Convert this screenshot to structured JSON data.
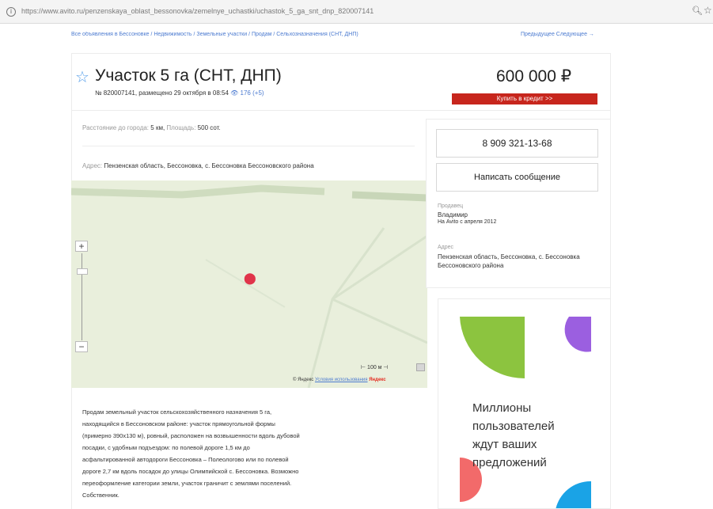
{
  "browser": {
    "url": "https://www.avito.ru/penzenskaya_oblast_bessonovka/zemelnye_uchastki/uchastok_5_ga_snt_dnp_820007141",
    "info_icon": "info-icon",
    "zoom_icon": "zoom-icon",
    "bookmark_icon": "star-icon"
  },
  "breadcrumbs": {
    "text": "Все объявления в Бессоновке / Недвижимость / Земельные участки / Продам / Сельхозназначения (СНТ, ДНП)",
    "right": "Предыдущее   Следующее →"
  },
  "listing": {
    "title": "Участок 5 га (СНТ, ДНП)",
    "meta": "№ 820007141, размещено 29 октября в 08:54",
    "views": "176 (+5)",
    "price": "600 000 ₽",
    "credit_button": "Купить в кредит >>"
  },
  "params": {
    "distance_label": "Расстояние до города:",
    "distance_value": "5 км",
    "area_label": "Площадь:",
    "area_value": "500 сот."
  },
  "address": {
    "label": "Адрес:",
    "value": "Пензенская область, Бессоновка, с. Бессоновка Бессоновского района"
  },
  "map": {
    "zoom_in": "+",
    "zoom_out": "−",
    "scale": "100 м",
    "credit_prefix": "© Яндекс",
    "credit_link": "Условия использования",
    "credit_brand": "Яндекс",
    "pin_color": "#e0344a"
  },
  "description": [
    "Продам земельный участок сельскохозяйственного назначения 5 га,",
    "находящийся в Бессоновском районе: участок прямоугольной формы",
    "(примерно 390х130 м), ровный, расположен на возвышенности вдоль дубовой",
    "посадки, с удобным подъездом: по полевой дороге 1,5 км до",
    "асфальтированной автодороги Бессоновка – Полеологово или по полевой",
    "дороге 2,7 км вдоль посадок до улицы Олимпийской с. Бессоновка. Возможно",
    "переоформление категории земли, участок граничит с землями поселений.",
    "Собственник."
  ],
  "contact": {
    "phone": "8 909 321-13-68",
    "message_button": "Написать сообщение",
    "seller_label": "Продавец",
    "seller_name": "Владимир",
    "seller_since": "На Avito с апреля 2012",
    "address_label": "Адрес",
    "address_value": "Пензенская область, Бессоновка, с. Бессоновка Бессоновского района"
  },
  "ad": {
    "lines": [
      "Миллионы",
      "пользователей",
      "ждут ваших",
      "предложений"
    ]
  },
  "colors": {
    "link": "#4c7bd0",
    "credit_red": "#c7261d",
    "ad_green": "#8cc43f",
    "ad_purple": "#9b5fe0",
    "ad_red": "#f26a6a",
    "ad_blue": "#1aa3e6"
  }
}
